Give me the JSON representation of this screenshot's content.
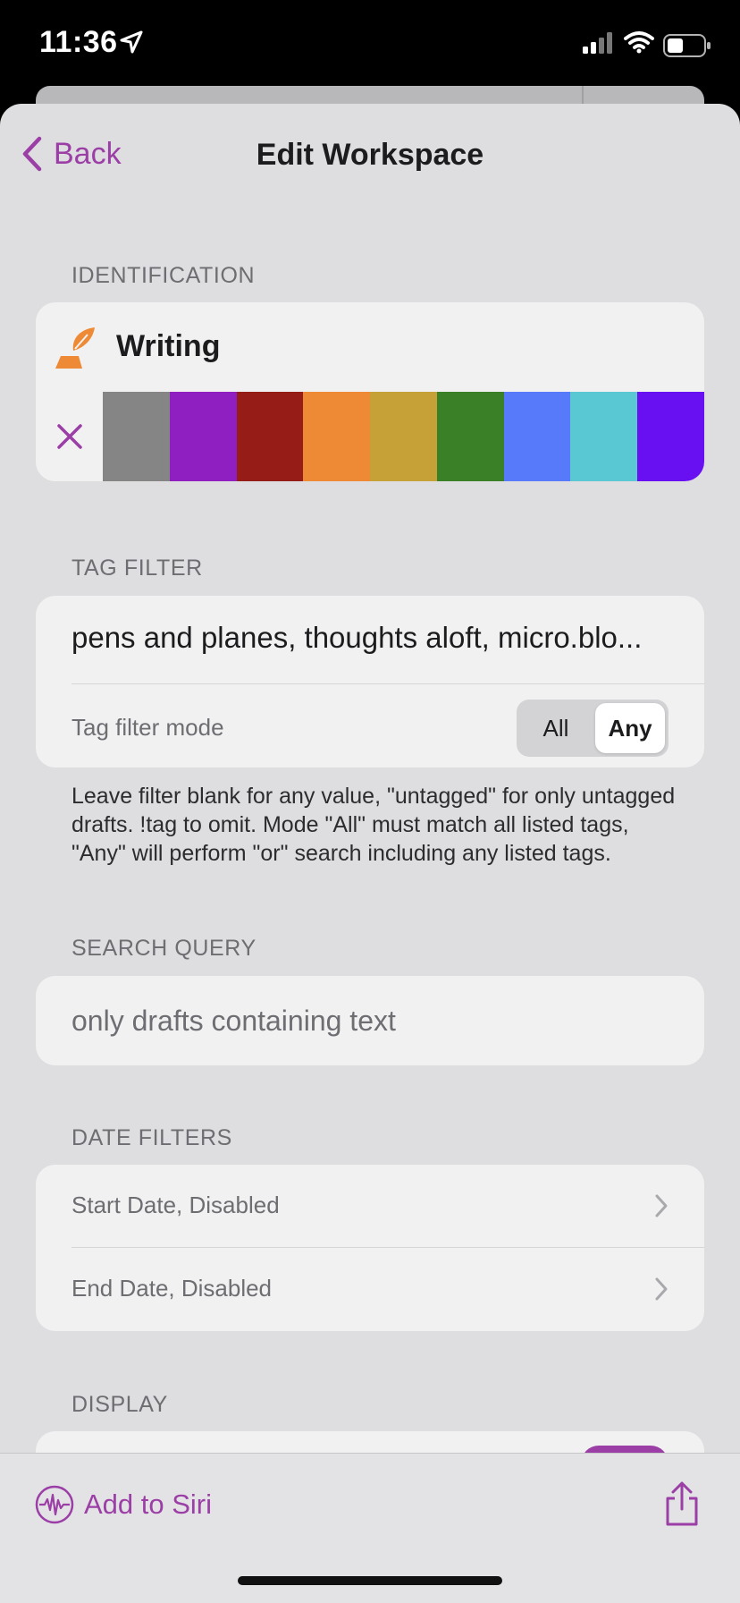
{
  "status_bar": {
    "time": "11:36"
  },
  "nav": {
    "back_label": "Back",
    "title": "Edit Workspace"
  },
  "identification": {
    "section_label": "IDENTIFICATION",
    "name": "Writing",
    "icon": "quill-pen-icon",
    "colors": [
      "#858585",
      "#8f1fc0",
      "#961d17",
      "#ee8a35",
      "#c5a138",
      "#3a8026",
      "#567afa",
      "#5ac8d3",
      "#6810f2"
    ]
  },
  "tag_filter": {
    "section_label": "TAG FILTER",
    "value": "pens and planes, thoughts aloft, micro.blo...",
    "mode_label": "Tag filter mode",
    "mode_options": [
      "All",
      "Any"
    ],
    "mode_selected": "Any",
    "help_text": "Leave filter blank for any value, \"untagged\" for only untagged drafts. !tag to omit. Mode \"All\" must match all listed tags, \"Any\" will perform \"or\" search including any listed tags."
  },
  "search_query": {
    "section_label": "SEARCH QUERY",
    "placeholder": "only drafts containing text"
  },
  "date_filters": {
    "section_label": "DATE FILTERS",
    "start": "Start Date, Disabled",
    "end": "End Date, Disabled"
  },
  "display": {
    "section_label": "DISPLAY"
  },
  "toolbar": {
    "siri_label": "Add to Siri"
  },
  "accent_color": "#9b3fa6"
}
